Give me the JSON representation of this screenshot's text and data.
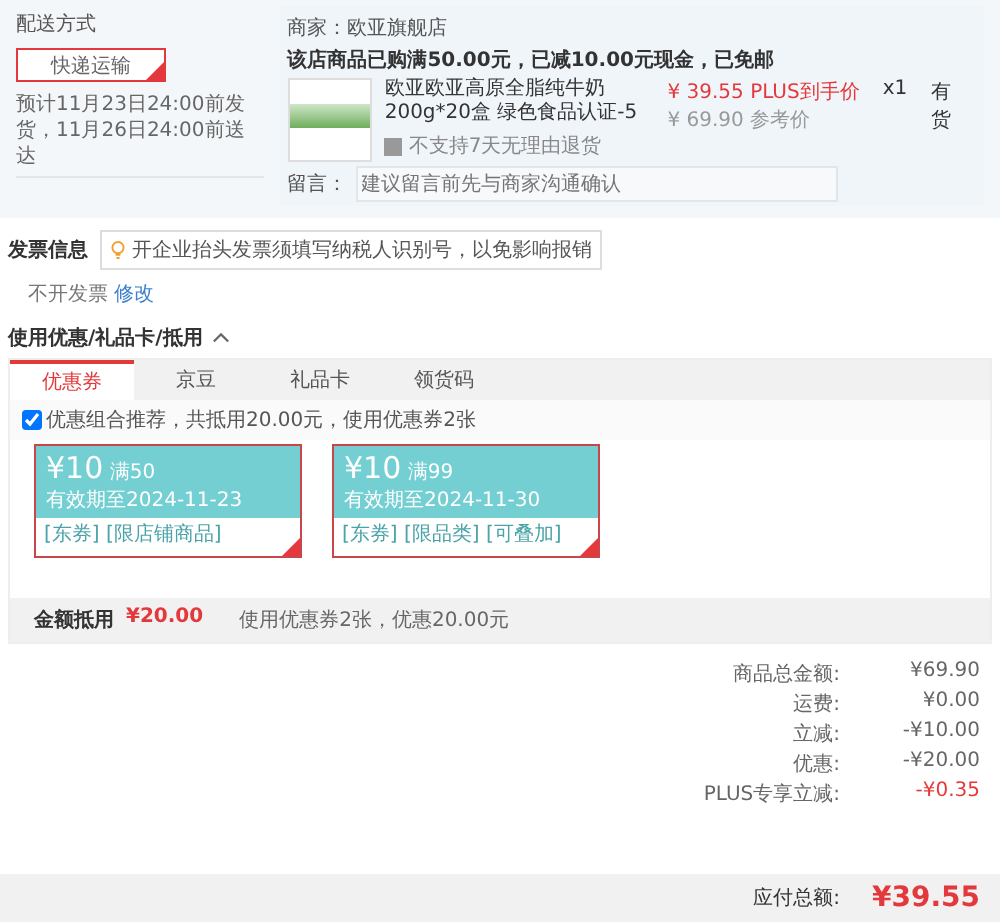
{
  "delivery": {
    "title": "配送方式",
    "option": {
      "label": "快递运输",
      "selected": true
    },
    "estimate": "预计11月23日24:00前发货，11月26日24:00前送达"
  },
  "shop": {
    "seller": "商家：欧亚旗舰店",
    "promo": "该店商品已购满50.00元，已减10.00元现金，已免邮",
    "item": {
      "name": "欧亚欧亚高原全脂纯牛奶200g*20盒 绿色食品认证-5",
      "return_note": "不支持7天无理由退货",
      "price": "¥ 39.55 PLUS到手价",
      "ref_price": "¥ 69.90 参考价",
      "qty": "x1",
      "stock": "有货"
    },
    "message": {
      "label": "留言：",
      "placeholder": "建议留言前先与商家沟通确认"
    }
  },
  "invoice": {
    "title": "发票信息",
    "tip": "开企业抬头发票须填写纳税人识别号，以免影响报销",
    "value": "不开发票",
    "edit": "修改"
  },
  "discount": {
    "title": "使用优惠/礼品卡/抵用",
    "expanded": true,
    "tabs": [
      {
        "label": "优惠券",
        "selected": true
      },
      {
        "label": "京豆",
        "selected": false
      },
      {
        "label": "礼品卡",
        "selected": false
      },
      {
        "label": "领货码",
        "selected": false
      }
    ],
    "recommend": {
      "checked": true,
      "label": "优惠组合推荐，共抵用20.00元，使用优惠券2张"
    },
    "coupons": [
      {
        "amount": "¥10",
        "condition": "满50",
        "validity": "有效期至2024-11-23",
        "tags": "[东券] [限店铺商品]",
        "selected": true
      },
      {
        "amount": "¥10",
        "condition": "满99",
        "validity": "有效期至2024-11-30",
        "tags": "[东券] [限品类] [可叠加]",
        "selected": true
      }
    ],
    "footer": {
      "label": "金额抵用",
      "amount": "¥20.00",
      "note": "使用优惠券2张，优惠20.00元"
    }
  },
  "summary": [
    {
      "label": "商品总金额:",
      "value": "¥69.90",
      "kind": "plain"
    },
    {
      "label": "运费:",
      "value": "¥0.00",
      "kind": "plain"
    },
    {
      "label": "立减:",
      "value": "-¥10.00",
      "kind": "plain"
    },
    {
      "label": "优惠:",
      "value": "-¥20.00",
      "kind": "plain"
    },
    {
      "label": "PLUS专享立减:",
      "value": "-¥0.35",
      "kind": "red"
    }
  ],
  "total": {
    "label": "应付总额:",
    "value": "¥39.55"
  }
}
